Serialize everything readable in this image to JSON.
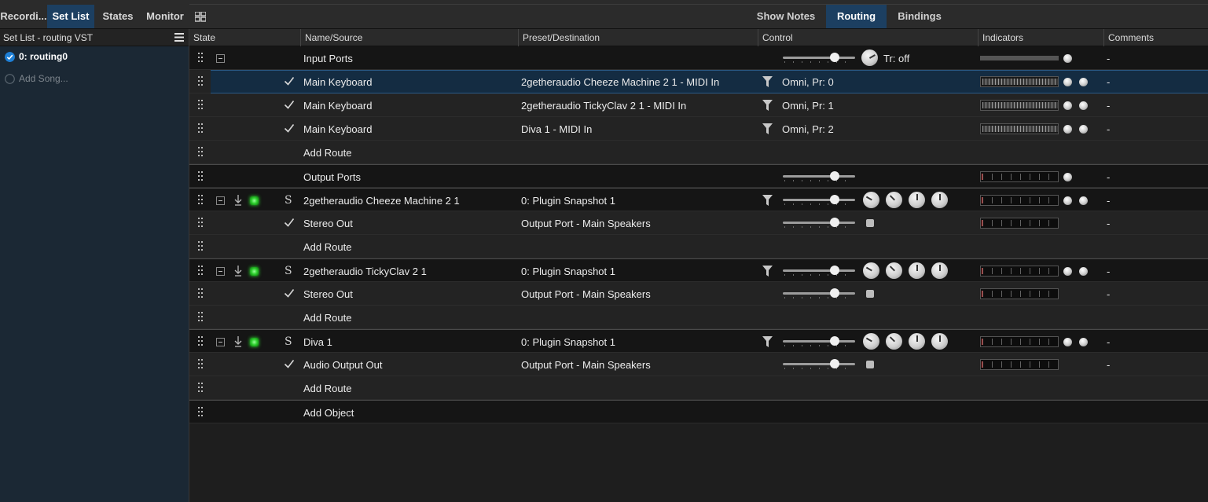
{
  "top_tabs": [
    {
      "label": "Recordi..."
    },
    {
      "label": "Set List"
    },
    {
      "label": "States"
    },
    {
      "label": "Monitor"
    }
  ],
  "right_tabs": [
    {
      "label": "Show Notes"
    },
    {
      "label": "Routing"
    },
    {
      "label": "Bindings"
    }
  ],
  "left_panel": {
    "title": "Set List - routing VST",
    "items": [
      {
        "label": "0: routing0"
      },
      {
        "label": "Add Song..."
      }
    ]
  },
  "columns": [
    "State",
    "Name/Source",
    "Preset/Destination",
    "Control",
    "Indicators",
    "Comments"
  ],
  "rows": [
    {
      "name": "Input Ports",
      "preset": "",
      "control": "",
      "tr": "Tr: off",
      "comment": "-"
    },
    {
      "name": "Main Keyboard",
      "preset": "2getheraudio Cheeze Machine 2 1 - MIDI In",
      "control": "Omni, Pr: 0",
      "comment": "-"
    },
    {
      "name": "Main Keyboard",
      "preset": "2getheraudio TickyClav 2 1 - MIDI In",
      "control": "Omni, Pr: 1",
      "comment": "-"
    },
    {
      "name": "Main Keyboard",
      "preset": "Diva 1 - MIDI In",
      "control": "Omni, Pr: 2",
      "comment": "-"
    },
    {
      "name": "Add Route"
    },
    {
      "name": "Output Ports",
      "comment": "-"
    },
    {
      "solo": "S",
      "name": "2getheraudio Cheeze Machine 2 1",
      "preset": "0: Plugin Snapshot 1",
      "comment": "-"
    },
    {
      "name": "Stereo Out",
      "preset": "Output Port - Main Speakers",
      "comment": "-"
    },
    {
      "name": "Add Route"
    },
    {
      "solo": "S",
      "name": "2getheraudio TickyClav 2 1",
      "preset": "0: Plugin Snapshot 1",
      "comment": "-"
    },
    {
      "name": "Stereo Out",
      "preset": "Output Port - Main Speakers",
      "comment": "-"
    },
    {
      "name": "Add Route"
    },
    {
      "solo": "S",
      "name": "Diva 1",
      "preset": "0: Plugin Snapshot 1",
      "comment": "-"
    },
    {
      "name": "Audio Output Out",
      "preset": "Output Port - Main Speakers",
      "comment": "-"
    },
    {
      "name": "Add Route"
    },
    {
      "name": "Add Object"
    }
  ],
  "colors": {
    "accent": "#1c3f61",
    "selection": "#142c42",
    "led_green": "#2fd12f",
    "checkbox_blue": "#1e7fd6"
  }
}
